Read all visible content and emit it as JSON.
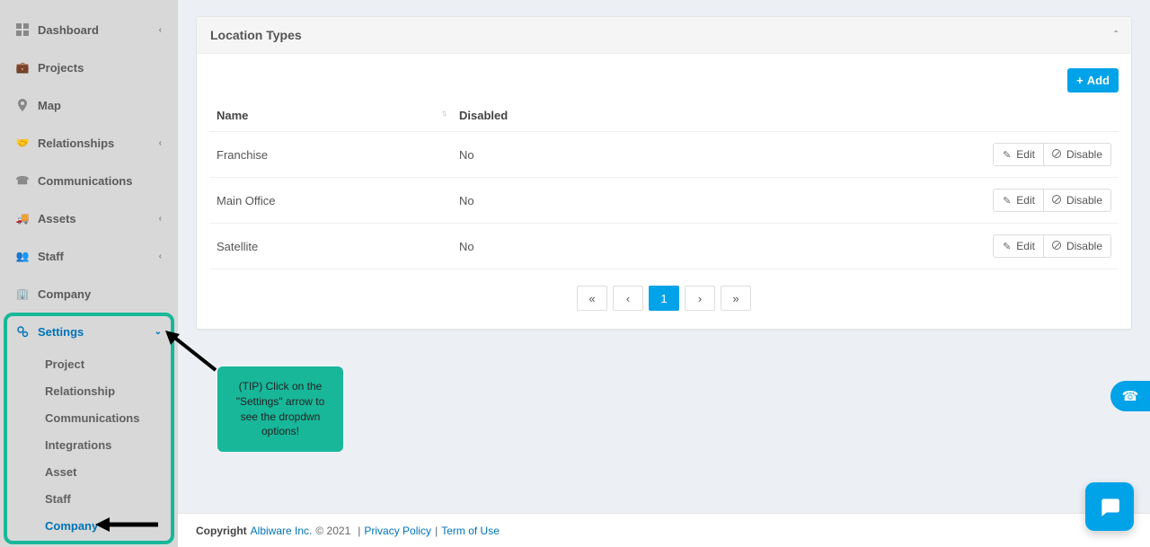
{
  "sidebar": {
    "items": [
      {
        "label": "Dashboard",
        "icon": "dashboard-icon",
        "expandable": true
      },
      {
        "label": "Projects",
        "icon": "briefcase-icon",
        "expandable": false
      },
      {
        "label": "Map",
        "icon": "pin-icon",
        "expandable": false
      },
      {
        "label": "Relationships",
        "icon": "handshake-icon",
        "expandable": true
      },
      {
        "label": "Communications",
        "icon": "phone-icon",
        "expandable": false
      },
      {
        "label": "Assets",
        "icon": "truck-icon",
        "expandable": true
      },
      {
        "label": "Staff",
        "icon": "users-icon",
        "expandable": true
      },
      {
        "label": "Company",
        "icon": "building-icon",
        "expandable": false
      }
    ],
    "settings": {
      "label": "Settings",
      "icon": "gears-icon",
      "open": true,
      "subitems": [
        {
          "label": "Project"
        },
        {
          "label": "Relationship"
        },
        {
          "label": "Communications"
        },
        {
          "label": "Integrations"
        },
        {
          "label": "Asset"
        },
        {
          "label": "Staff"
        },
        {
          "label": "Company",
          "active": true
        }
      ]
    }
  },
  "panel": {
    "title": "Location Types",
    "add_label": "Add",
    "columns": {
      "name": "Name",
      "disabled": "Disabled"
    },
    "rows": [
      {
        "name": "Franchise",
        "disabled": "No"
      },
      {
        "name": "Main Office",
        "disabled": "No"
      },
      {
        "name": "Satellite",
        "disabled": "No"
      }
    ],
    "actions": {
      "edit": "Edit",
      "disable": "Disable"
    },
    "pagination": {
      "first": "«",
      "prev": "‹",
      "current": "1",
      "next": "›",
      "last": "»"
    }
  },
  "tip": {
    "text": "(TIP) Click on the \"Settings\" arrow to see the dropdwn options!"
  },
  "footer": {
    "copyright_label": "Copyright",
    "company": "Albiware Inc.",
    "year": "© 2021",
    "privacy": "Privacy Policy",
    "terms": "Term of Use"
  }
}
